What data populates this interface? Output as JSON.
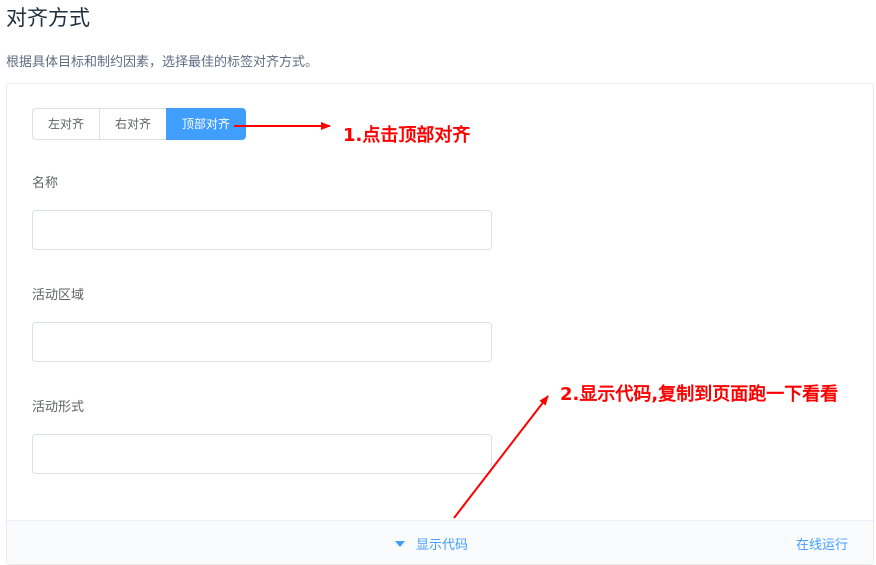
{
  "header": {
    "title": "对齐方式",
    "description": "根据具体目标和制约因素，选择最佳的标签对齐方式。"
  },
  "demo": {
    "align_options": [
      "左对齐",
      "右对齐",
      "顶部对齐"
    ],
    "selected_align": "顶部对齐",
    "fields": [
      {
        "label": "名称",
        "value": ""
      },
      {
        "label": "活动区域",
        "value": ""
      },
      {
        "label": "活动形式",
        "value": ""
      }
    ],
    "show_code_label": "显示代码",
    "run_online_label": "在线运行"
  },
  "annotations": {
    "step1": "1.点击顶部对齐",
    "step2": "2.显示代码,复制到页面跑一下看看"
  },
  "colors": {
    "accent": "#409eff",
    "annotation": "#ff0000"
  },
  "icons": {
    "show_code": "caret-down-icon"
  }
}
